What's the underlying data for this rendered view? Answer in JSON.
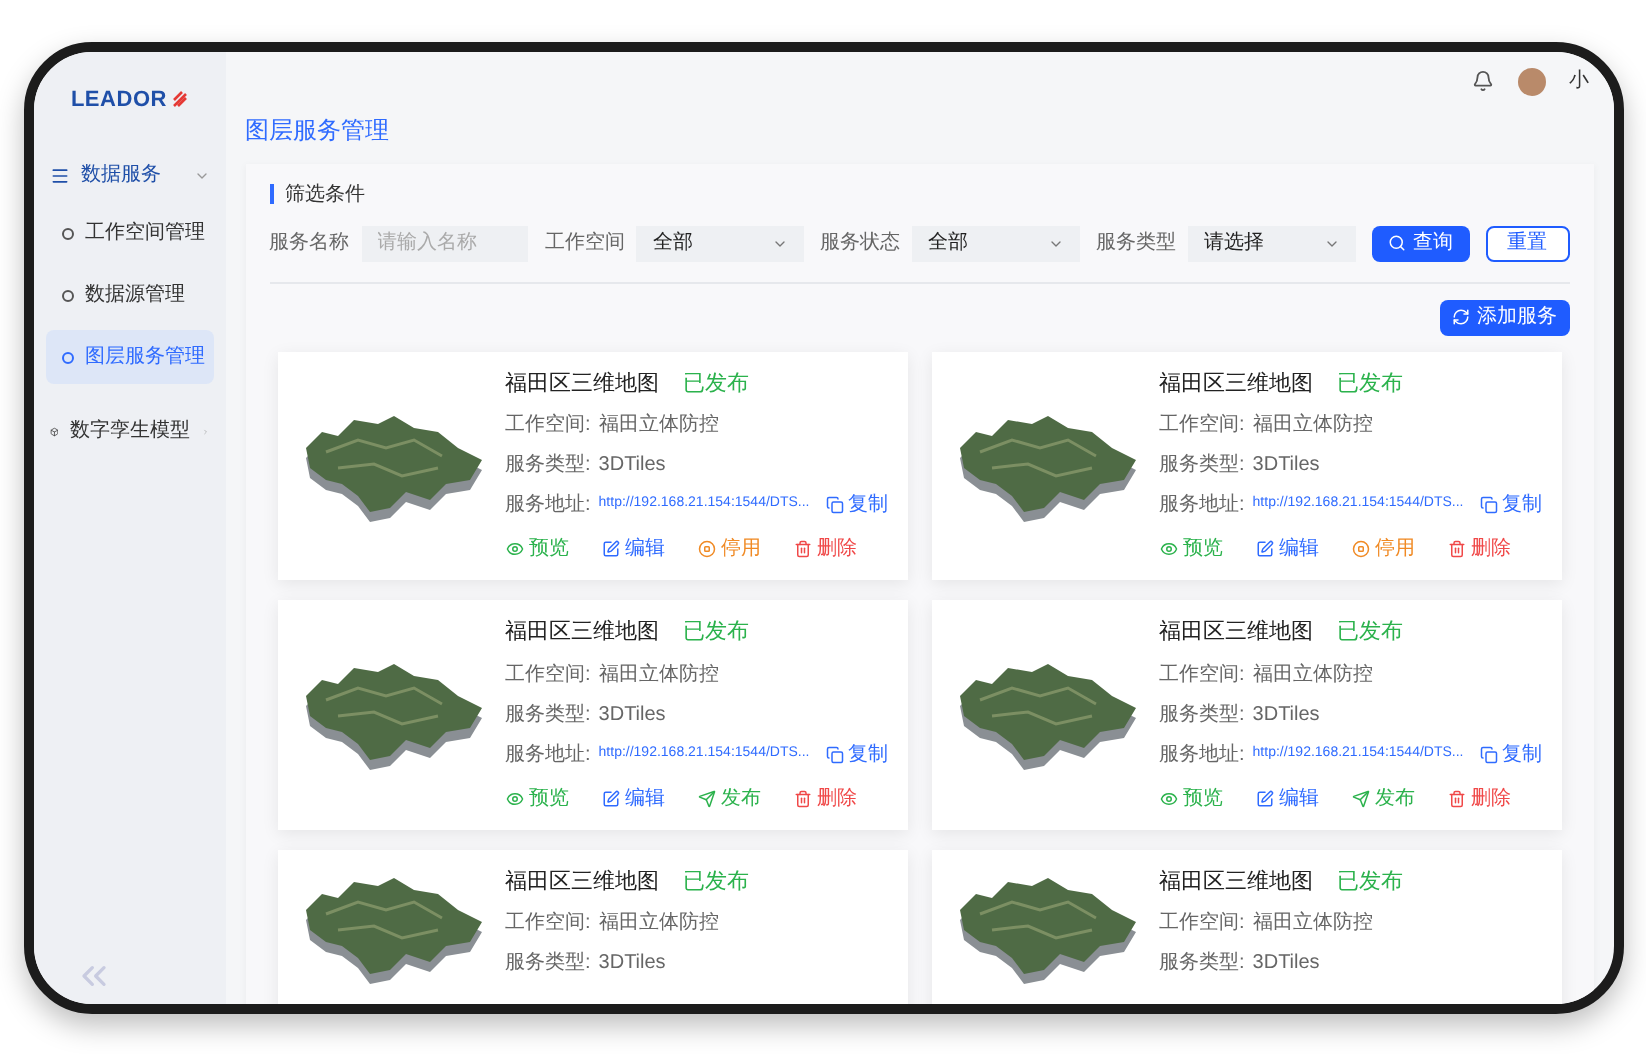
{
  "logo": {
    "text": "LEADOR"
  },
  "sidebar": {
    "items": [
      {
        "label": "数据服务",
        "kind": "group",
        "expanded": true,
        "children": [
          {
            "label": "工作空间管理",
            "selected": false
          },
          {
            "label": "数据源管理",
            "selected": false
          },
          {
            "label": "图层服务管理",
            "selected": true
          }
        ]
      },
      {
        "label": "数字孪生模型",
        "kind": "group2",
        "expanded": false
      }
    ]
  },
  "header": {
    "user": "小"
  },
  "page_title": "图层服务管理",
  "filter": {
    "title": "筛选条件",
    "fields": [
      {
        "label": "服务名称",
        "kind": "input",
        "placeholder": "请输入名称"
      },
      {
        "label": "工作空间",
        "kind": "select",
        "value": "全部"
      },
      {
        "label": "服务状态",
        "kind": "select",
        "value": "全部"
      },
      {
        "label": "服务类型",
        "kind": "select",
        "value": "请选择"
      }
    ],
    "buttons": [
      {
        "label": "查询",
        "kind": "primary"
      },
      {
        "label": "重置",
        "kind": "outline"
      }
    ]
  },
  "add_button": "添加服务",
  "cards": [
    {
      "title": "福田区三维地图",
      "status": "已发布",
      "lines": [
        {
          "label": "工作空间:",
          "value": "福田立体防控"
        },
        {
          "label": "服务类型:",
          "value": "3DTiles"
        }
      ],
      "url_label": "服务地址:",
      "url": "http://192.168.21.154:1544/DTS...",
      "copy": "复制",
      "actions": [
        {
          "label": "预览",
          "kind": "preview"
        },
        {
          "label": "编辑",
          "kind": "edit"
        },
        {
          "label": "停用",
          "kind": "disable"
        },
        {
          "label": "删除",
          "kind": "delete"
        }
      ]
    },
    {
      "title": "福田区三维地图",
      "status": "已发布",
      "lines": [
        {
          "label": "工作空间:",
          "value": "福田立体防控"
        },
        {
          "label": "服务类型:",
          "value": "3DTiles"
        }
      ],
      "url_label": "服务地址:",
      "url": "http://192.168.21.154:1544/DTS...",
      "copy": "复制",
      "actions": [
        {
          "label": "预览",
          "kind": "preview"
        },
        {
          "label": "编辑",
          "kind": "edit"
        },
        {
          "label": "停用",
          "kind": "disable"
        },
        {
          "label": "删除",
          "kind": "delete"
        }
      ]
    },
    {
      "title": "福田区三维地图",
      "status": "已发布",
      "lines": [
        {
          "label": "工作空间:",
          "value": "福田立体防控"
        },
        {
          "label": "服务类型:",
          "value": "3DTiles"
        }
      ],
      "url_label": "服务地址:",
      "url": "http://192.168.21.154:1544/DTS...",
      "copy": "复制",
      "actions": [
        {
          "label": "预览",
          "kind": "preview"
        },
        {
          "label": "编辑",
          "kind": "edit"
        },
        {
          "label": "发布",
          "kind": "publish"
        },
        {
          "label": "删除",
          "kind": "delete"
        }
      ]
    },
    {
      "title": "福田区三维地图",
      "status": "已发布",
      "lines": [
        {
          "label": "工作空间:",
          "value": "福田立体防控"
        },
        {
          "label": "服务类型:",
          "value": "3DTiles"
        }
      ],
      "url_label": "服务地址:",
      "url": "http://192.168.21.154:1544/DTS...",
      "copy": "复制",
      "actions": [
        {
          "label": "预览",
          "kind": "preview"
        },
        {
          "label": "编辑",
          "kind": "edit"
        },
        {
          "label": "发布",
          "kind": "publish"
        },
        {
          "label": "删除",
          "kind": "delete"
        }
      ]
    },
    {
      "title": "福田区三维地图",
      "status": "已发布",
      "lines": [
        {
          "label": "工作空间:",
          "value": "福田立体防控"
        },
        {
          "label": "服务类型:",
          "value": "3DTiles"
        }
      ]
    },
    {
      "title": "福田区三维地图",
      "status": "已发布",
      "lines": [
        {
          "label": "工作空间:",
          "value": "福田立体防控"
        },
        {
          "label": "服务类型:",
          "value": "3DTiles"
        }
      ]
    }
  ]
}
